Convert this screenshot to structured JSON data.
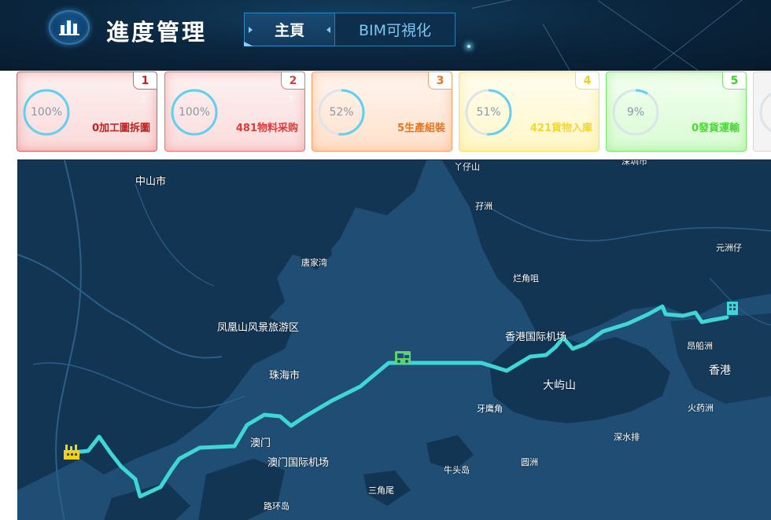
{
  "header": {
    "app_title": "進度管理",
    "logo_icon": "bar-chart-icon",
    "tabs": [
      {
        "label": "主頁",
        "active": true
      },
      {
        "label": "BIM可視化",
        "active": false
      }
    ]
  },
  "cards": [
    {
      "index": "1",
      "percent": "100%",
      "progress": 1.0,
      "label": "0加工圖拆圖",
      "color": "#c42020",
      "ring_color": "#5fd0f0"
    },
    {
      "index": "2",
      "percent": "100%",
      "progress": 1.0,
      "label": "481物料采购",
      "color": "#e03a3a",
      "ring_color": "#5fd0f0"
    },
    {
      "index": "3",
      "percent": "52%",
      "progress": 0.52,
      "label": "5生產組裝",
      "color": "#e8741f",
      "ring_color": "#5fd0f0"
    },
    {
      "index": "4",
      "percent": "51%",
      "progress": 0.51,
      "label": "421貨物入庫",
      "color": "#f4d72a",
      "ring_color": "#5fd0f0"
    },
    {
      "index": "5",
      "percent": "9%",
      "progress": 0.09,
      "label": "0發貨運輸",
      "color": "#49d836",
      "ring_color": "#5fd0f0"
    }
  ],
  "map": {
    "route_color": "#3fd6d6",
    "markers": [
      {
        "name": "factory-icon",
        "color": "#f5d21a"
      },
      {
        "name": "truck-icon",
        "color": "#5fd36a"
      },
      {
        "name": "building-icon",
        "color": "#3fd6d6"
      }
    ],
    "places": [
      {
        "text": "中山市"
      },
      {
        "text": "丫仔山"
      },
      {
        "text": "孖洲"
      },
      {
        "text": "深圳市"
      },
      {
        "text": "元洲仔"
      },
      {
        "text": "唐家湾"
      },
      {
        "text": "烂角咀"
      },
      {
        "text": "凤凰山风景旅游区"
      },
      {
        "text": "香港国际机场"
      },
      {
        "text": "昂船洲"
      },
      {
        "text": "珠海市"
      },
      {
        "text": "大屿山"
      },
      {
        "text": "香港"
      },
      {
        "text": "牙鹰角"
      },
      {
        "text": "火药洲"
      },
      {
        "text": "澳门"
      },
      {
        "text": "深水排"
      },
      {
        "text": "澳门国际机场"
      },
      {
        "text": "圆洲"
      },
      {
        "text": "牛头岛"
      },
      {
        "text": "三角尾"
      },
      {
        "text": "路环岛"
      }
    ]
  }
}
